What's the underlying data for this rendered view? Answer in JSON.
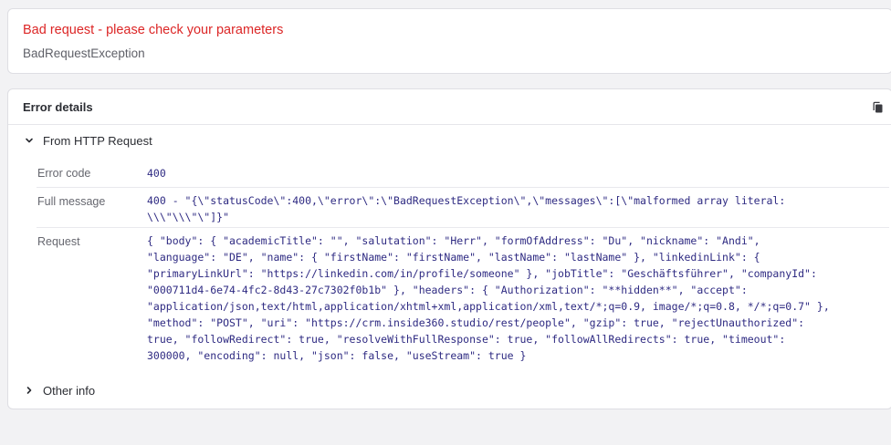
{
  "error": {
    "title": "Bad request - please check your parameters",
    "type": "BadRequestException",
    "title_color": "#dc2626"
  },
  "details": {
    "title": "Error details",
    "copy_icon": "copy-icon",
    "http_section": {
      "label": "From HTTP Request",
      "expanded": true,
      "rows": [
        {
          "label": "Error code",
          "value": "400"
        },
        {
          "label": "Full message",
          "value": "400 - \"{\\\"statusCode\\\":400,\\\"error\\\":\\\"BadRequestException\\\",\\\"messages\\\":[\\\"malformed array literal:\n\\\\\\\"\\\\\\\"\\\"]}\""
        },
        {
          "label": "Request",
          "value": "{ \"body\": { \"academicTitle\": \"\", \"salutation\": \"Herr\", \"formOfAddress\": \"Du\", \"nickname\": \"Andi\",\n\"language\": \"DE\", \"name\": { \"firstName\": \"firstName\", \"lastName\": \"lastName\" }, \"linkedinLink\": {\n\"primaryLinkUrl\": \"https://linkedin.com/in/profile/someone\" }, \"jobTitle\": \"Geschäftsführer\", \"companyId\":\n\"000711d4-6e74-4fc2-8d43-27c7302f0b1b\" }, \"headers\": { \"Authorization\": \"**hidden**\", \"accept\":\n\"application/json,text/html,application/xhtml+xml,application/xml,text/*;q=0.9, image/*;q=0.8, */*;q=0.7\" },\n\"method\": \"POST\", \"uri\": \"https://crm.inside360.studio/rest/people\", \"gzip\": true, \"rejectUnauthorized\":\ntrue, \"followRedirect\": true, \"resolveWithFullResponse\": true, \"followAllRedirects\": true, \"timeout\":\n300000, \"encoding\": null, \"json\": false, \"useStream\": true }"
        }
      ]
    },
    "other_section": {
      "label": "Other info",
      "expanded": false
    }
  }
}
